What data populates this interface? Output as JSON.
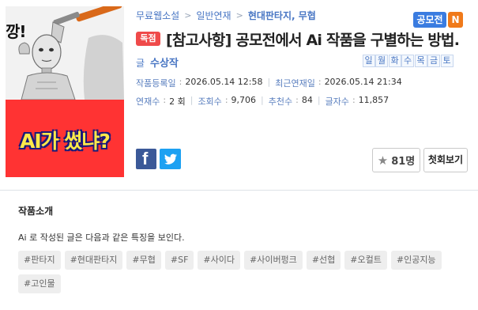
{
  "cover": {
    "shout_text": "깡!",
    "title_text": "AI가 썼냐?"
  },
  "breadcrumb": {
    "items": [
      "무료웹소설",
      "일반연재",
      "현대판타지, 무협"
    ],
    "separator": ">"
  },
  "badges": {
    "contest": "공모전",
    "new": "N",
    "exclusive": "독점"
  },
  "work": {
    "title": "[참고사항] 공모전에서 Ai 작품을 구별하는 방법.",
    "author_prefix": "글",
    "author": "수상작"
  },
  "days": [
    "일",
    "월",
    "화",
    "수",
    "목",
    "금",
    "토"
  ],
  "stats": {
    "registered_label": "작품등록일",
    "registered_value": "2026.05.14 12:58",
    "latest_label": "최근연재일",
    "latest_value": "2026.05.14 21:34",
    "episodes_label": "연재수",
    "episodes_value": "2 회",
    "views_label": "조회수",
    "views_value": "9,706",
    "recommends_label": "추천수",
    "recommends_value": "84",
    "chars_label": "글자수",
    "chars_value": "11,857"
  },
  "actions": {
    "recommend_count": "81명",
    "first_episode": "첫회보기"
  },
  "intro": {
    "heading": "작품소개",
    "text": "Ai 로 작성된 글은 다음과 같은 특징을 보인다."
  },
  "tags": [
    "#판타지",
    "#현대판타지",
    "#무협",
    "#SF",
    "#사이다",
    "#사이버펑크",
    "#선협",
    "#오컬트",
    "#인공지능",
    "#고인물"
  ],
  "colors": {
    "link_blue": "#4a77c4",
    "contest_badge": "#3a7ce0",
    "new_badge": "#f07a1a",
    "exclusive_badge": "#ef4a4a",
    "facebook": "#3b5998",
    "twitter": "#1da1f2",
    "cover_red": "#ff3333",
    "cover_title_yellow": "#ffe94a"
  },
  "icons": {
    "facebook": "facebook-icon",
    "twitter": "twitter-icon",
    "star": "star-icon"
  }
}
